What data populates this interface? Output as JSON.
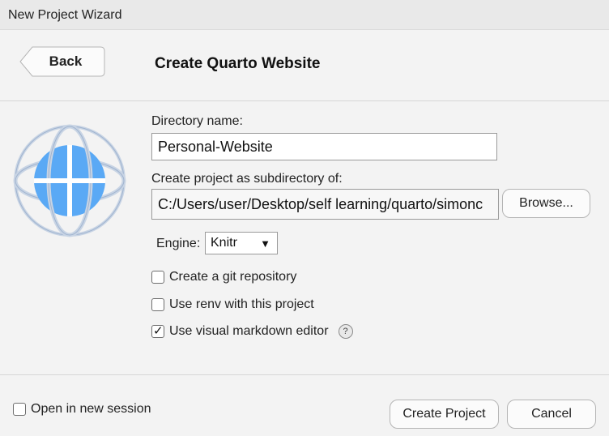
{
  "window": {
    "title": "New Project Wizard"
  },
  "header": {
    "back_label": "Back",
    "page_title": "Create Quarto Website"
  },
  "icons": {
    "project": "quarto-globe-icon",
    "help": "help-icon"
  },
  "form": {
    "directory_label": "Directory name:",
    "directory_value": "Personal-Website",
    "subdirectory_label": "Create project as subdirectory of:",
    "subdirectory_value": "C:/Users/user/Desktop/self learning/quarto/simonc",
    "browse_label": "Browse...",
    "engine_label": "Engine:",
    "engine_value": "Knitr",
    "git_label": "Create a git repository",
    "git_checked": false,
    "renv_label": "Use renv with this project",
    "renv_checked": false,
    "visual_label": "Use visual markdown editor",
    "visual_checked": true,
    "help_symbol": "?"
  },
  "footer": {
    "new_session_label": "Open in new session",
    "new_session_checked": false,
    "create_label": "Create Project",
    "cancel_label": "Cancel"
  },
  "colors": {
    "globe_blue": "#5aa9f5",
    "background": "#f3f3f3"
  }
}
